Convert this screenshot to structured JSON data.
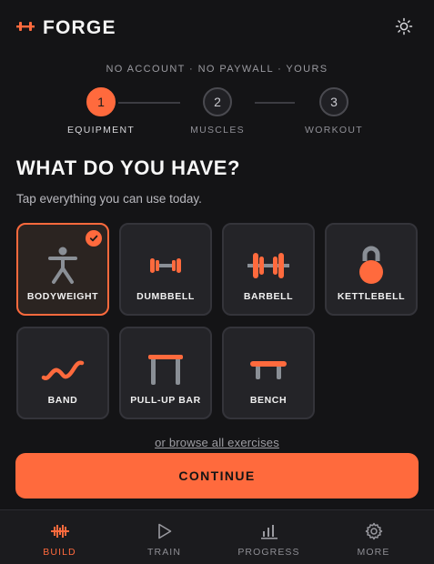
{
  "app": {
    "name": "FORGE",
    "logo_icon": "dumbbell-logo-icon",
    "theme_toggle_icon": "sun-icon"
  },
  "tagline": "NO ACCOUNT · NO PAYWALL · YOURS",
  "stepper": {
    "steps": [
      {
        "number": "1",
        "label": "EQUIPMENT",
        "active": true
      },
      {
        "number": "2",
        "label": "MUSCLES",
        "active": false
      },
      {
        "number": "3",
        "label": "WORKOUT",
        "active": false
      }
    ]
  },
  "main": {
    "title": "WHAT DO YOU HAVE?",
    "subtitle": "Tap everything you can use today."
  },
  "equipment": [
    {
      "label": "BODYWEIGHT",
      "icon": "person-icon",
      "selected": true
    },
    {
      "label": "DUMBBELL",
      "icon": "dumbbell-icon",
      "selected": false
    },
    {
      "label": "BARBELL",
      "icon": "barbell-icon",
      "selected": false
    },
    {
      "label": "KETTLEBELL",
      "icon": "kettlebell-icon",
      "selected": false
    },
    {
      "label": "BAND",
      "icon": "band-icon",
      "selected": false
    },
    {
      "label": "PULL-UP BAR",
      "icon": "pullup-bar-icon",
      "selected": false
    },
    {
      "label": "BENCH",
      "icon": "bench-icon",
      "selected": false
    }
  ],
  "browse_link": "or browse all exercises",
  "continue_label": "CONTINUE",
  "tabbar": {
    "tabs": [
      {
        "label": "BUILD",
        "icon": "build-icon",
        "active": true
      },
      {
        "label": "TRAIN",
        "icon": "play-icon",
        "active": false
      },
      {
        "label": "PROGRESS",
        "icon": "bar-chart-icon",
        "active": false
      },
      {
        "label": "MORE",
        "icon": "gear-icon",
        "active": false
      }
    ]
  },
  "colors": {
    "accent": "#ff6a3d",
    "background": "#141416",
    "card": "#242428",
    "icon_gray": "#8a8f96"
  }
}
